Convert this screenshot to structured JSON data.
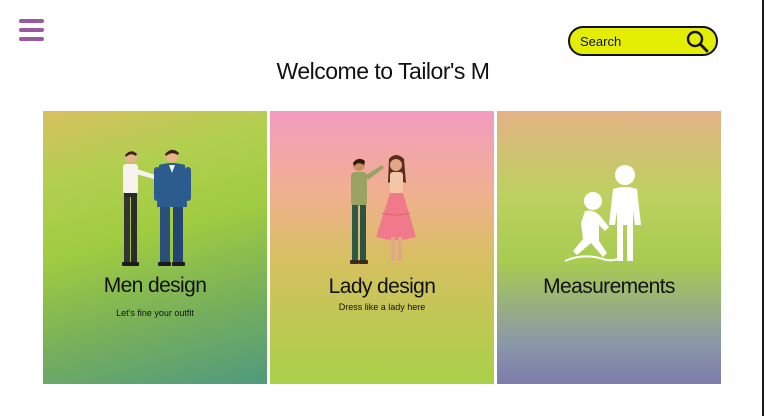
{
  "header": {
    "menu_icon": "hamburger-menu-icon",
    "search": {
      "placeholder": "Search",
      "icon": "search-icon",
      "color": "#e4ee04"
    }
  },
  "title": "Welcome to Tailor's M",
  "cards": [
    {
      "title": "Men design",
      "subtitle": "Let's fine your outfit",
      "icon": "tailor-fitting-men-illustration"
    },
    {
      "title": "Lady design",
      "subtitle": "Dress like a lady here",
      "icon": "tailor-fitting-lady-illustration"
    },
    {
      "title": "Measurements",
      "subtitle": "",
      "icon": "measurement-icon"
    }
  ],
  "colors": {
    "menu": "#9a5aa3",
    "text": "#111111"
  }
}
